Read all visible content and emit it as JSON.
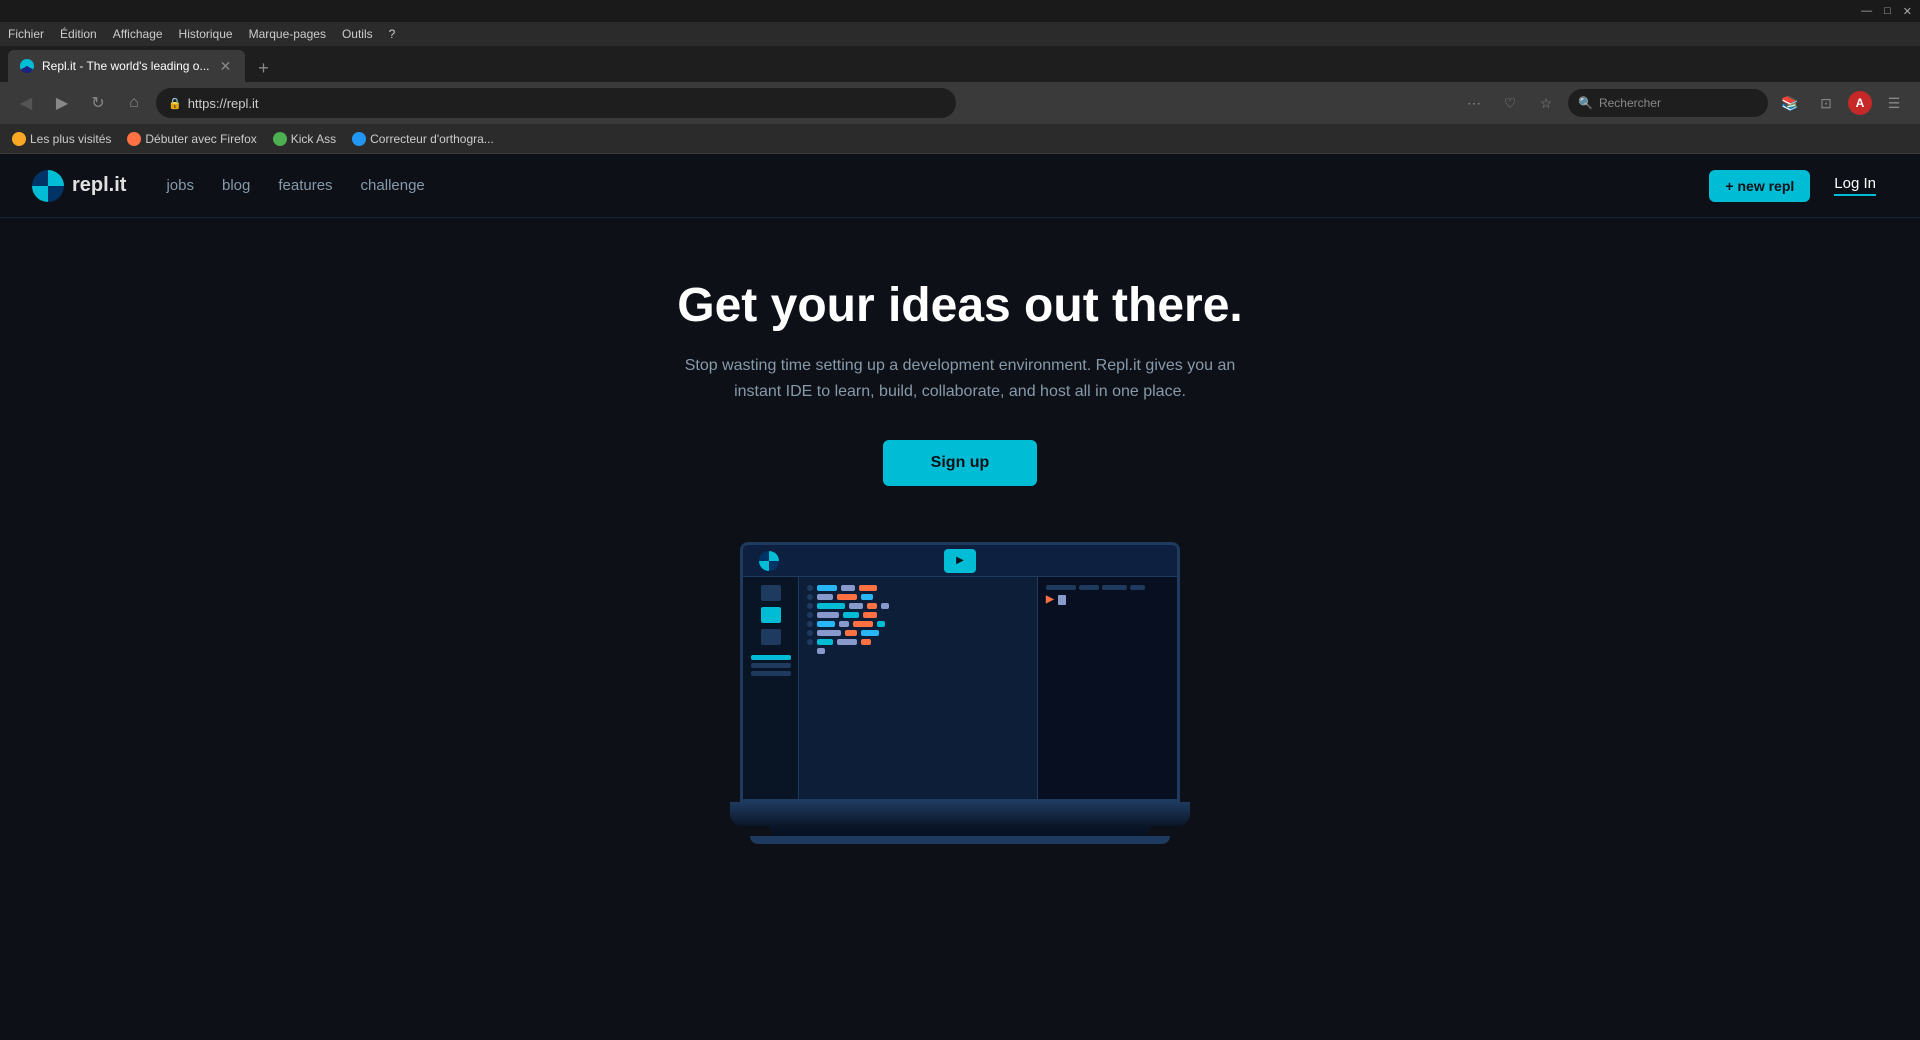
{
  "os": {
    "titlebar_buttons": [
      "—",
      "□",
      "✕"
    ]
  },
  "browser": {
    "menu_items": [
      "Fichier",
      "Édition",
      "Affichage",
      "Historique",
      "Marque-pages",
      "Outils",
      "?"
    ],
    "tab": {
      "title": "Repl.it - The world's leading o...",
      "favicon": "replit"
    },
    "new_tab_label": "+",
    "address": "https://repl.it",
    "search_placeholder": "Rechercher",
    "bookmarks": [
      {
        "label": "Les plus visités",
        "type": "star"
      },
      {
        "label": "Débuter avec Firefox",
        "type": "ff"
      },
      {
        "label": "Kick Ass",
        "type": "ka"
      },
      {
        "label": "Correcteur d'orthogra...",
        "type": "co"
      }
    ]
  },
  "nav": {
    "logo_text": "repl.it",
    "links": [
      {
        "label": "jobs",
        "key": "jobs"
      },
      {
        "label": "blog",
        "key": "blog"
      },
      {
        "label": "features",
        "key": "features"
      },
      {
        "label": "challenge",
        "key": "challenge"
      }
    ],
    "new_repl_label": "+ new repl",
    "login_label": "Log In"
  },
  "hero": {
    "title": "Get your ideas out there.",
    "subtitle": "Stop wasting time setting up a development environment. Repl.it gives you an instant IDE to learn, build, collaborate, and host all in one place.",
    "cta_label": "Sign up"
  }
}
